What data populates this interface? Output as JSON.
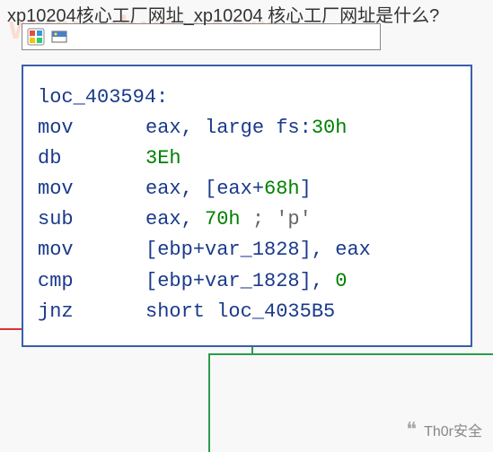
{
  "watermark": "www.xhyey.com",
  "title": "xp10204核心工厂网址_xp10204 核心工厂网址是什么?",
  "code": {
    "label": "loc_403594:",
    "lines": [
      {
        "mnemonic": "mov",
        "ops": [
          {
            "t": "reg",
            "v": "eax"
          },
          {
            "t": "punct",
            "v": ", "
          },
          {
            "t": "reg",
            "v": "large fs"
          },
          {
            "t": "punct",
            "v": ":"
          },
          {
            "t": "num",
            "v": "30h"
          }
        ]
      },
      {
        "mnemonic": "db",
        "ops": [
          {
            "t": "num",
            "v": "3Eh"
          }
        ]
      },
      {
        "mnemonic": "mov",
        "ops": [
          {
            "t": "reg",
            "v": "eax"
          },
          {
            "t": "punct",
            "v": ", ["
          },
          {
            "t": "reg",
            "v": "eax"
          },
          {
            "t": "punct",
            "v": "+"
          },
          {
            "t": "num",
            "v": "68h"
          },
          {
            "t": "punct",
            "v": "]"
          }
        ]
      },
      {
        "mnemonic": "sub",
        "ops": [
          {
            "t": "reg",
            "v": "eax"
          },
          {
            "t": "punct",
            "v": ", "
          },
          {
            "t": "num",
            "v": "70h"
          },
          {
            "t": "comment",
            "v": " ; 'p'"
          }
        ]
      },
      {
        "mnemonic": "mov",
        "ops": [
          {
            "t": "punct",
            "v": "["
          },
          {
            "t": "reg",
            "v": "ebp"
          },
          {
            "t": "punct",
            "v": "+"
          },
          {
            "t": "var",
            "v": "var_1828"
          },
          {
            "t": "punct",
            "v": "], "
          },
          {
            "t": "reg",
            "v": "eax"
          }
        ]
      },
      {
        "mnemonic": "cmp",
        "ops": [
          {
            "t": "punct",
            "v": "["
          },
          {
            "t": "reg",
            "v": "ebp"
          },
          {
            "t": "punct",
            "v": "+"
          },
          {
            "t": "var",
            "v": "var_1828"
          },
          {
            "t": "punct",
            "v": "], "
          },
          {
            "t": "num",
            "v": "0"
          }
        ]
      },
      {
        "mnemonic": "jnz",
        "ops": [
          {
            "t": "reg",
            "v": "short loc_4035B5"
          }
        ]
      }
    ]
  },
  "footer": {
    "brand": "Th0r安全"
  }
}
